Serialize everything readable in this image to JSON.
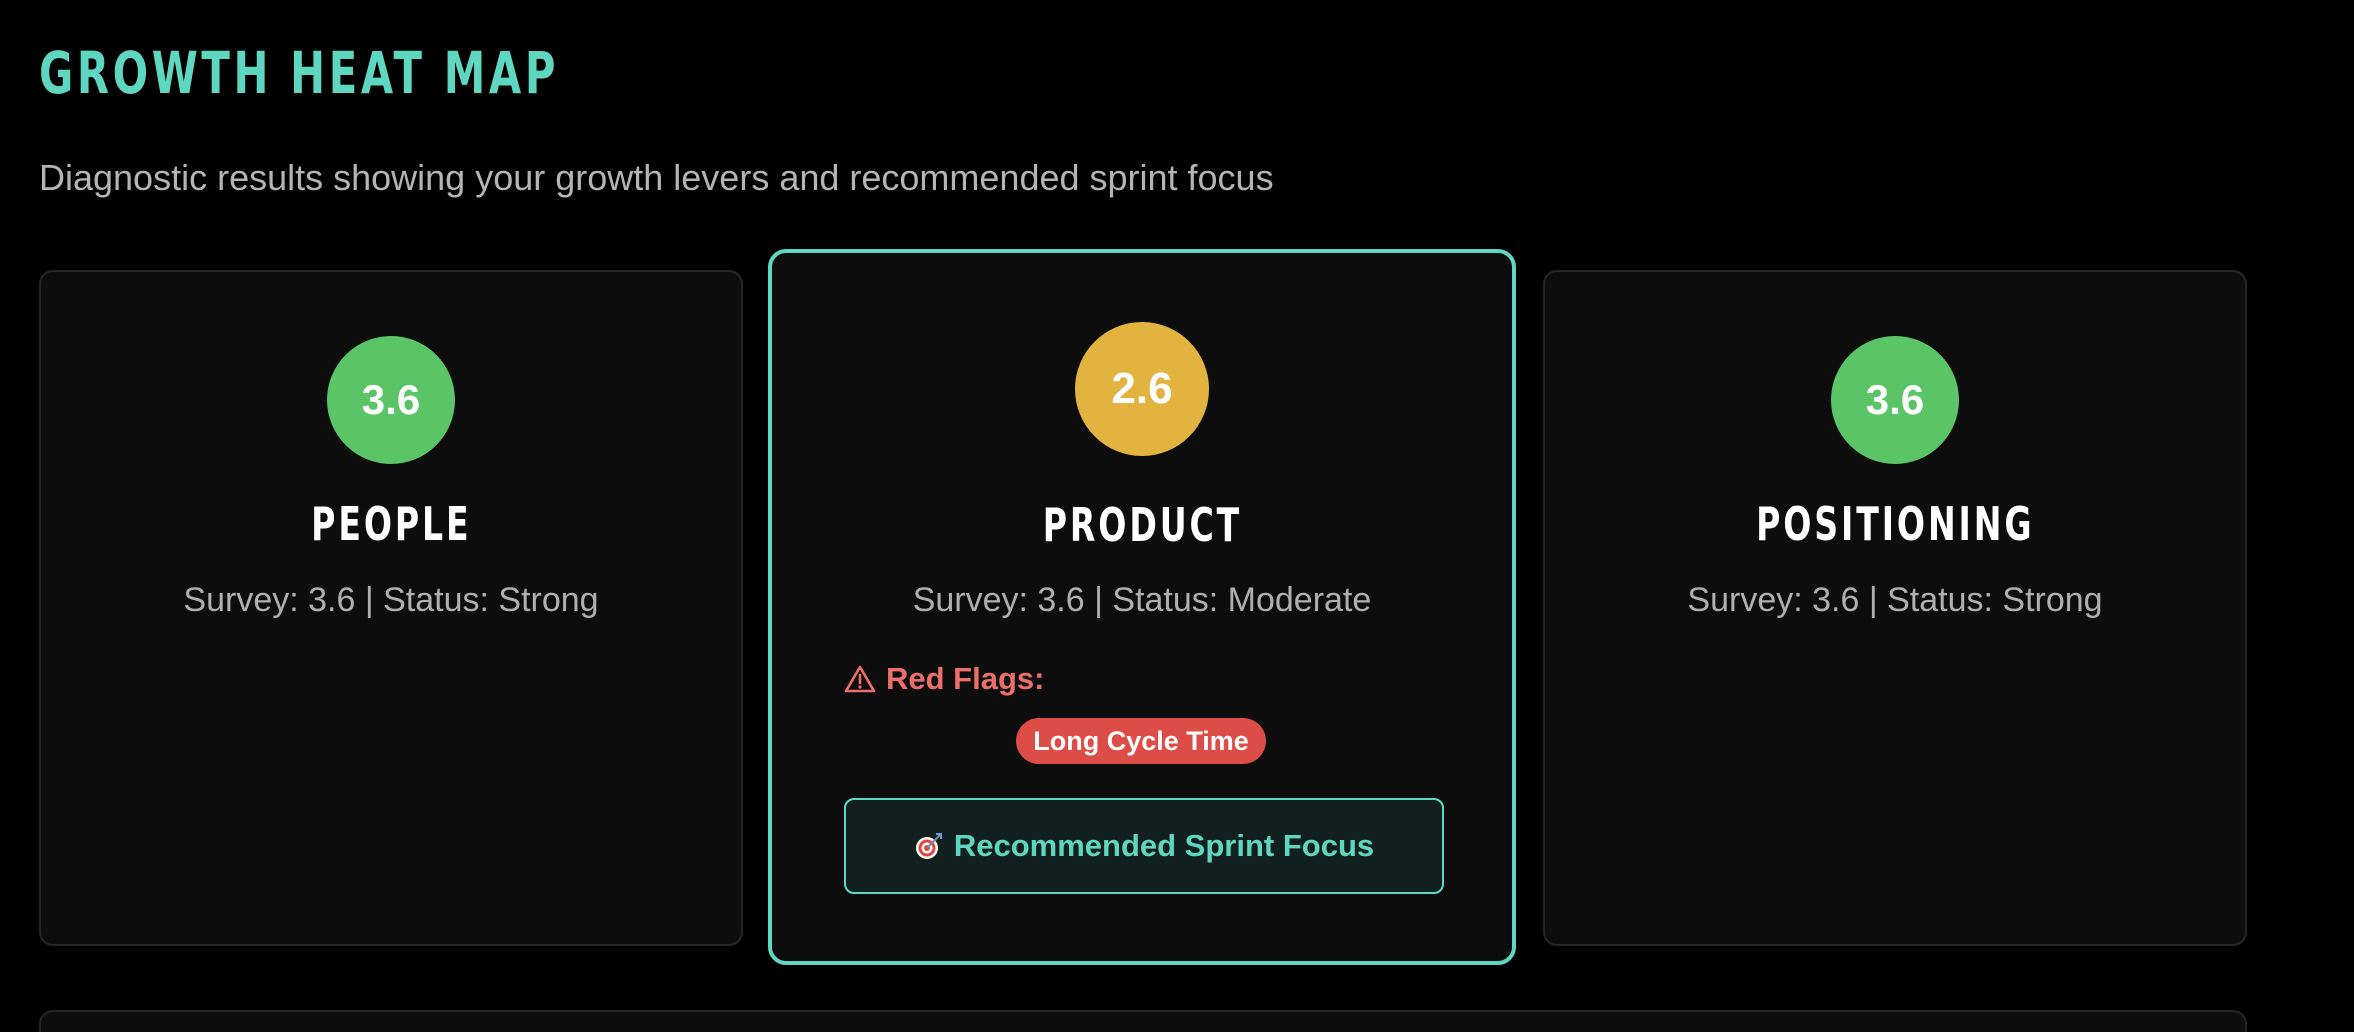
{
  "header": {
    "title": "GROWTH HEAT MAP",
    "subtitle": "Diagnostic results showing your growth levers and recommended sprint focus"
  },
  "colors": {
    "accent": "#5fd6c0",
    "strong": "#5bc466",
    "moderate": "#e2b43f",
    "red_flag": "#dc4d47"
  },
  "pillars": [
    {
      "score": "3.6",
      "name": "PEOPLE",
      "meta": "Survey: 3.6 | Status: Strong",
      "status_color": "green"
    },
    {
      "score": "2.6",
      "name": "PRODUCT",
      "meta": "Survey: 3.6 | Status: Moderate",
      "status_color": "yellow",
      "red_flags_label": "Red Flags:",
      "red_flags": [
        "Long Cycle Time"
      ],
      "sprint_focus_label": "Recommended Sprint Focus",
      "sprint_focus_icon": "target-icon",
      "warning_icon": "warning-triangle-icon"
    },
    {
      "score": "3.6",
      "name": "POSITIONING",
      "meta": "Survey: 3.6 | Status: Strong",
      "status_color": "green"
    }
  ]
}
